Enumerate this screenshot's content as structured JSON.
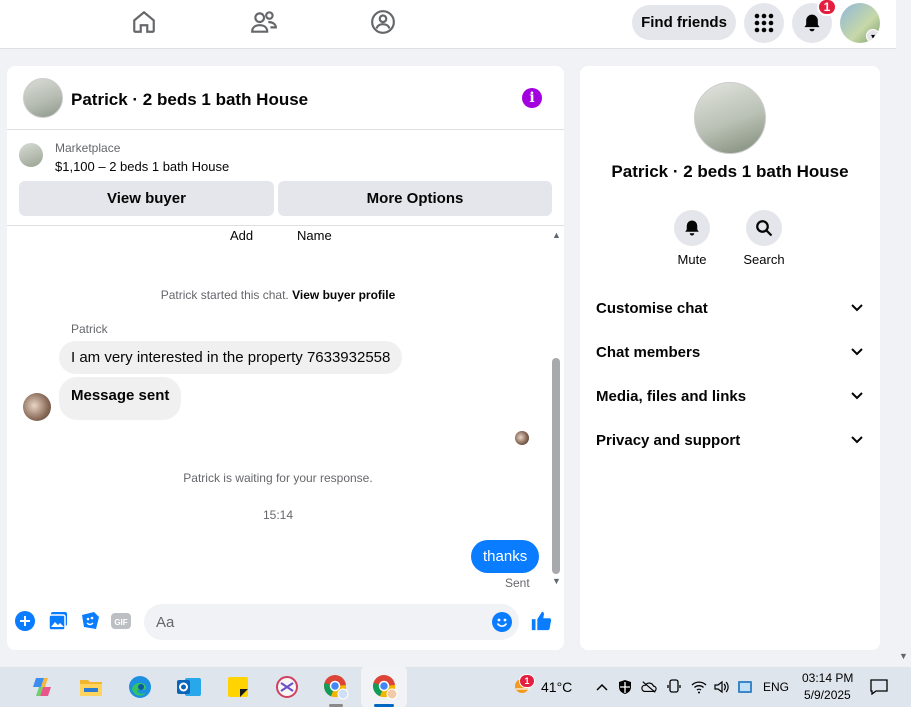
{
  "topbar": {
    "find_friends": "Find friends",
    "notification_count": "1",
    "icons": [
      "home-icon",
      "friends-icon",
      "groups-icon",
      "menu-grid-icon",
      "bell-icon"
    ]
  },
  "chat": {
    "title": "Patrick · 2 beds 1 bath House",
    "marketplace_label": "Marketplace",
    "listing": "$1,100 – 2 beds 1 bath House",
    "view_buyer": "View buyer",
    "more_options": "More Options",
    "table_cols": [
      "Add",
      "Name"
    ],
    "started_text": "Patrick started this chat.",
    "view_buyer_profile": "View buyer profile",
    "sender_name": "Patrick",
    "messages_in": [
      "I am very interested in the property 7633932558",
      "Message sent"
    ],
    "waiting_text": "Patrick is waiting for your response.",
    "timestamp": "15:14",
    "message_out": "thanks",
    "sent_status": "Sent",
    "input_placeholder": "Aa"
  },
  "side": {
    "title": "Patrick · 2 beds 1 bath House",
    "mute": "Mute",
    "search": "Search",
    "sections": [
      "Customise chat",
      "Chat members",
      "Media, files and links",
      "Privacy and support"
    ]
  },
  "taskbar": {
    "weather": "41°C",
    "weather_badge": "1",
    "lang": "ENG",
    "time": "03:14 PM",
    "date": "5/9/2025"
  },
  "colors": {
    "accent": "#0a7cff",
    "info": "#a300e0",
    "badge": "#e41e3f"
  }
}
